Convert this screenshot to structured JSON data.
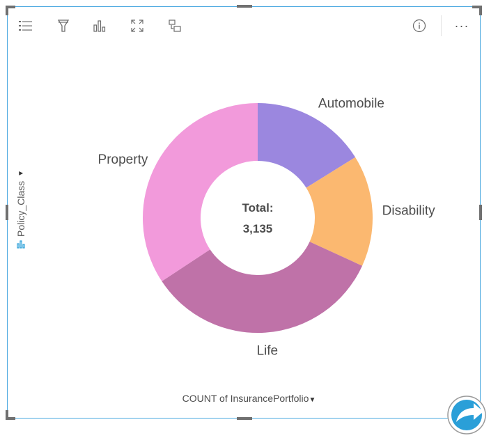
{
  "toolbar": {
    "icons": [
      "legend-icon",
      "filter-icon",
      "visualization-type-icon",
      "maximize-icon",
      "flip-card-icon",
      "info-icon",
      "more-options-icon"
    ],
    "more_label": "···"
  },
  "colors": {
    "card_border": "#4aa8e0",
    "accent": "#2a9fd8",
    "Automobile": "#9b87df",
    "Disability": "#fbb870",
    "Life": "#bf72a8",
    "Property": "#f29adb"
  },
  "axes": {
    "y_label": "Policy_Class",
    "x_label": "COUNT of InsurancePortfolio"
  },
  "chart_data": {
    "type": "pie",
    "donut": true,
    "center_label": "Total:",
    "center_value": "3,135",
    "categories": [
      "Automobile",
      "Disability",
      "Life",
      "Property"
    ],
    "values": [
      506,
      492,
      1062,
      1075
    ],
    "total": 3135
  }
}
